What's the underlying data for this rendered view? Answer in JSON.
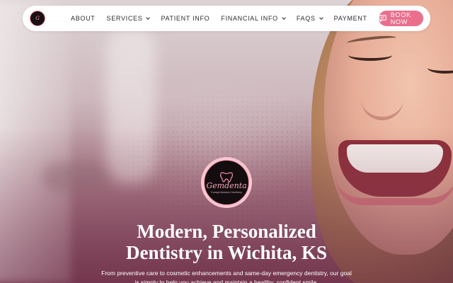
{
  "nav": {
    "logo_text": "G",
    "links": [
      {
        "label": "ABOUT",
        "dropdown": false
      },
      {
        "label": "SERVICES",
        "dropdown": true
      },
      {
        "label": "PATIENT INFO",
        "dropdown": false
      },
      {
        "label": "FINANCIAL INFO",
        "dropdown": true
      },
      {
        "label": "FAQS",
        "dropdown": true
      },
      {
        "label": "PAYMENT",
        "dropdown": false
      }
    ],
    "cta_label": "BOOK NOW",
    "cta_icon": "calendar-chat-icon"
  },
  "hero": {
    "emblem_brand": "Gemdenta",
    "emblem_sub": "Comprehensive Dentistry",
    "headline_line1": "Modern, Personalized",
    "headline_line2": "Dentistry in Wichita, KS",
    "subtext": "From preventive care to cosmetic enhancements and same-day emergency dentistry, our goal is simply to help you achieve and maintain a healthy, confident smile."
  },
  "colors": {
    "accent": "#ea6f8c",
    "nav_bg": "#ffffff",
    "text_dark": "#2b2b2b"
  }
}
